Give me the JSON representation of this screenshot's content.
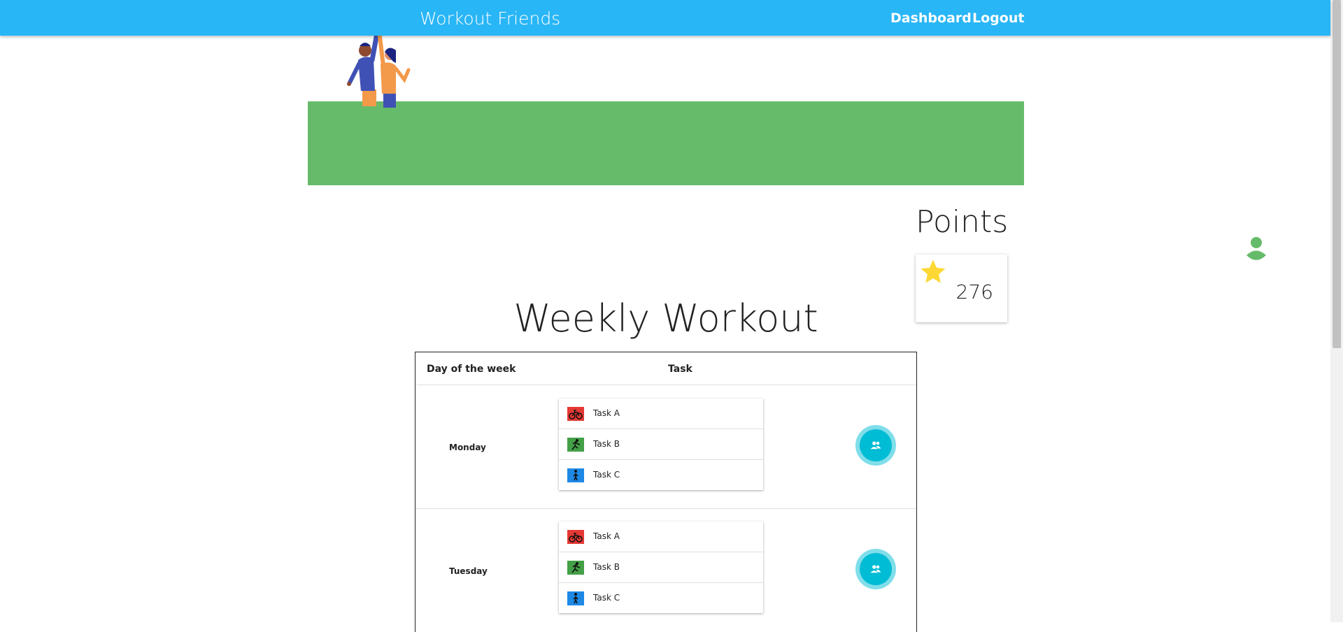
{
  "app": {
    "title": "Workout Friends",
    "nav": {
      "dashboard": "Dashboard",
      "logout": "Logout"
    }
  },
  "points": {
    "title": "Points",
    "value": "276"
  },
  "weekly": {
    "title": "Weekly Workout",
    "columns": {
      "day": "Day of the week",
      "task": "Task"
    },
    "days": [
      {
        "name": "Monday",
        "tasks": [
          {
            "label": "Task A",
            "icon": "bike-icon",
            "color": "#e53935"
          },
          {
            "label": "Task B",
            "icon": "run-icon",
            "color": "#43a047"
          },
          {
            "label": "Task C",
            "icon": "walk-icon",
            "color": "#1e88e5"
          }
        ]
      },
      {
        "name": "Tuesday",
        "tasks": [
          {
            "label": "Task A",
            "icon": "bike-icon",
            "color": "#e53935"
          },
          {
            "label": "Task B",
            "icon": "run-icon",
            "color": "#43a047"
          },
          {
            "label": "Task C",
            "icon": "walk-icon",
            "color": "#1e88e5"
          }
        ]
      }
    ]
  },
  "colors": {
    "appbar": "#29b6f6",
    "banner": "#66bb6a",
    "friends_button": "#00bcd4",
    "star": "#fdd835"
  }
}
